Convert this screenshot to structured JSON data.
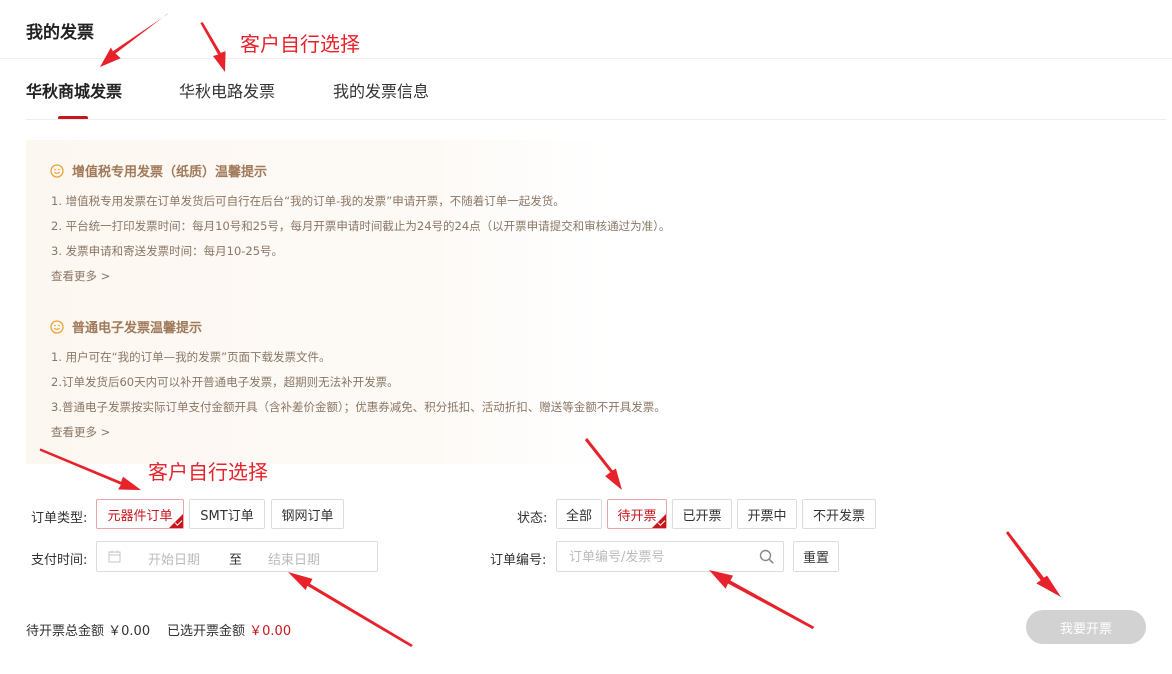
{
  "page": {
    "title": "我的发票"
  },
  "tabs": [
    {
      "label": "华秋商城发票",
      "active": true
    },
    {
      "label": "华秋电路发票",
      "active": false
    },
    {
      "label": "我的发票信息",
      "active": false
    }
  ],
  "notices": [
    {
      "title": "增值税专用发票（纸质）温馨提示",
      "lines": [
        "1. 增值税专用发票在订单发货后可自行在后台“我的订单-我的发票”申请开票，不随着订单一起发货。",
        "2. 平台统一打印发票时间：每月10号和25号，每月开票申请时间截止为24号的24点（以开票申请提交和审核通过为准）。",
        "3. 发票申请和寄送发票时间：每月10-25号。"
      ],
      "more": "查看更多 >"
    },
    {
      "title": "普通电子发票温馨提示",
      "lines": [
        "1. 用户可在“我的订单—我的发票”页面下载发票文件。",
        "2.订单发货后60天内可以补开普通电子发票，超期则无法补开发票。",
        "3.普通电子发票按实际订单支付金额开具（含补差价金额）；优惠券减免、积分抵扣、活动折扣、赠送等金额不开具发票。"
      ],
      "more": "查看更多 >"
    }
  ],
  "filters": {
    "order_type": {
      "label": "订单类型:",
      "options": [
        "元器件订单",
        "SMT订单",
        "钢网订单"
      ],
      "selected": "元器件订单"
    },
    "status": {
      "label": "状态:",
      "options": [
        "全部",
        "待开票",
        "已开票",
        "开票中",
        "不开发票"
      ],
      "selected": "待开票"
    },
    "pay_time": {
      "label": "支付时间:",
      "start_placeholder": "开始日期",
      "separator": "至",
      "end_placeholder": "结束日期"
    },
    "order_no": {
      "label": "订单编号:",
      "placeholder": "订单编号/发票号"
    },
    "reset_label": "重置"
  },
  "summary": {
    "pending_label": "待开票总金额",
    "pending_amount": "￥0.00",
    "selected_label": "已选开票金额",
    "selected_amount": "￥0.00"
  },
  "apply_button": "我要开票",
  "annotations": {
    "top": "客户自行选择",
    "middle": "客户自行选择"
  },
  "colors": {
    "accent": "#c8161d",
    "annotation": "#e8222a",
    "notice_text": "#8a7766",
    "disabled_button": "#d2d2d2"
  }
}
